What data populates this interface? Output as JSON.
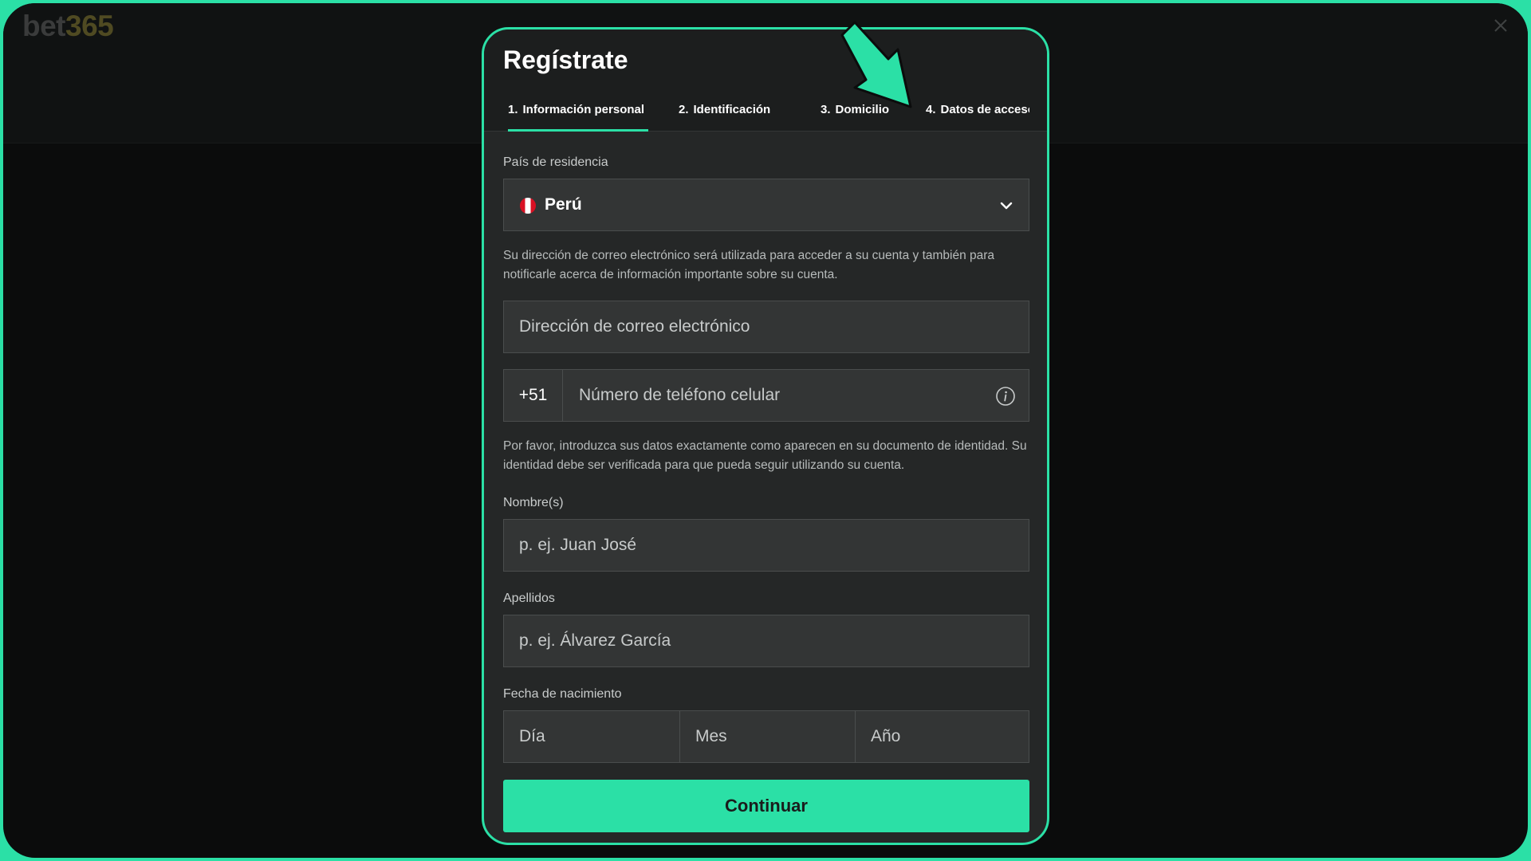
{
  "brand": {
    "logo_part1": "bet",
    "logo_part2": "365"
  },
  "modal": {
    "title": "Regístrate",
    "tabs": [
      {
        "num": "1.",
        "label": "Información personal",
        "active": true
      },
      {
        "num": "2.",
        "label": "Identificación",
        "active": false
      },
      {
        "num": "3.",
        "label": "Domicilio",
        "active": false
      },
      {
        "num": "4.",
        "label": "Datos de acceso",
        "active": false
      }
    ]
  },
  "form": {
    "country_label": "País de residencia",
    "country_value": "Perú",
    "email_help": "Su dirección de correo electrónico será utilizada para acceder a su cuenta y también para notificarle acerca de información importante sobre su cuenta.",
    "email_placeholder": "Dirección de correo electrónico",
    "phone_prefix": "+51",
    "phone_placeholder": "Número de teléfono celular",
    "identity_help": "Por favor, introduzca sus datos exactamente como aparecen en su documento de identidad. Su identidad debe ser verificada para que pueda seguir utilizando su cuenta.",
    "first_name_label": "Nombre(s)",
    "first_name_placeholder": "p. ej. Juan José",
    "last_name_label": "Apellidos",
    "last_name_placeholder": "p. ej. Álvarez García",
    "dob_label": "Fecha de nacimiento",
    "dob_day": "Día",
    "dob_month": "Mes",
    "dob_year": "Año",
    "continue_label": "Continuar"
  },
  "colors": {
    "accent": "#2be0a6",
    "modal_bg": "#252727",
    "input_bg": "#333535",
    "page_bg": "#0b0c0c"
  },
  "icons": [
    "close-icon",
    "peru-flag-icon",
    "chevron-down-icon",
    "info-icon",
    "arrow-pointer-icon"
  ]
}
